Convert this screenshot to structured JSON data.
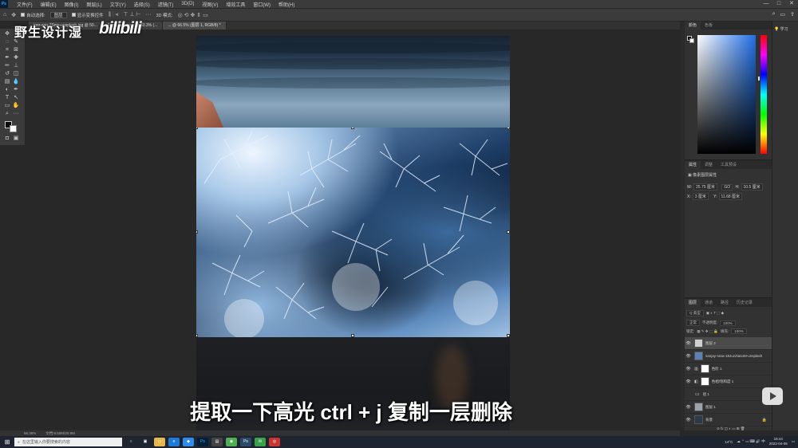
{
  "menubar": {
    "app_logo": "Ps",
    "items": [
      "文件(F)",
      "编辑(E)",
      "图像(I)",
      "图层(L)",
      "文字(Y)",
      "选择(S)",
      "滤镜(T)",
      "3D(D)",
      "视图(V)",
      "增效工具",
      "窗口(W)",
      "帮助(H)"
    ],
    "window_controls": [
      "—",
      "□",
      "✕"
    ]
  },
  "optionsbar": {
    "auto_select_label": "自动选择:",
    "auto_select_value": "图层",
    "transform_controls_label": "显示变换控件",
    "mode_label": "3D 模式:"
  },
  "doctabs": [
    {
      "label": "igor-son-2Sms-unsplash.jpg @ 50...",
      "active": false
    },
    {
      "label": "Frost Texture... @ 33.3% (...",
      "active": false
    },
    {
      "label": "... @ 66.5% (图层 1, RGB/8) *",
      "active": true
    }
  ],
  "watermark": {
    "text": "野生设计湿",
    "logo": "bilibili"
  },
  "subtitle": "提取一下高光 ctrl + j 复制一层删除",
  "statusbar": {
    "zoom": "66.36%",
    "doc": "文档:6.50M/20.9M"
  },
  "color_panel": {
    "tabs": [
      "颜色",
      "色板"
    ],
    "fg_color": "#000000",
    "bg_color": "#ffffff",
    "base_hue": "#1f6fe6"
  },
  "properties_panel": {
    "tabs": [
      "属性",
      "调整",
      "工具预设"
    ],
    "title": "像素图层属性",
    "w_label": "W:",
    "w_value": "25.75 厘米",
    "h_label": "H:",
    "h_value": "10.5 厘米",
    "x_label": "X:",
    "x_value": "3 厘米",
    "y_label": "Y:",
    "y_value": "11.68 厘米",
    "link": "GO"
  },
  "layers_panel": {
    "tabs": [
      "图层",
      "通道",
      "路径",
      "历史记录"
    ],
    "filter": "Q 类型",
    "blend_mode": "正常",
    "opacity_label": "不透明度:",
    "opacity_value": "100%",
    "lock_label": "锁定:",
    "fill_label": "填充:",
    "fill_value": "100%",
    "layers": [
      {
        "name": "图层 2",
        "visible": true,
        "selected": true,
        "thumb": "#cfcfcf"
      },
      {
        "name": "sanjay-rana-18JuzZiasoM-unsplash",
        "visible": true,
        "selected": false,
        "thumb": "#5b82b8"
      },
      {
        "name": "色阶 1",
        "visible": true,
        "selected": false,
        "thumb": "#ffffff"
      },
      {
        "name": "色相/饱和度 1",
        "visible": true,
        "selected": false,
        "thumb": "#ffffff"
      },
      {
        "name": "组 1",
        "visible": false,
        "selected": false,
        "thumb": "#777777"
      },
      {
        "name": "图层 1",
        "visible": true,
        "selected": false,
        "thumb": "#9aa2aa"
      },
      {
        "name": "背景",
        "visible": true,
        "selected": false,
        "thumb": "#2a3a4a"
      }
    ]
  },
  "right_strip": {
    "learn_label": "学习"
  },
  "taskbar": {
    "search_placeholder": "在这里输入你要搜索的内容",
    "weather": "14°C",
    "time": "16:44",
    "date": "2022-04-06"
  }
}
